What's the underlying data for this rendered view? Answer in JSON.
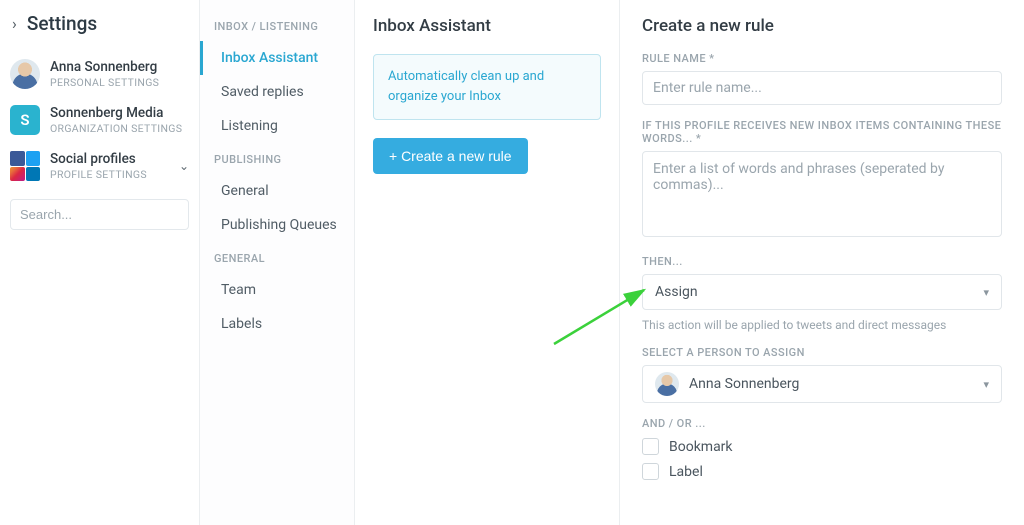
{
  "settings": {
    "title": "Settings",
    "personal": {
      "name": "Anna Sonnenberg",
      "sub": "PERSONAL SETTINGS"
    },
    "org": {
      "name": "Sonnenberg Media",
      "sub": "ORGANIZATION SETTINGS",
      "initial": "S"
    },
    "social": {
      "name": "Social profiles",
      "sub": "PROFILE SETTINGS"
    },
    "search_placeholder": "Search..."
  },
  "nav": {
    "sections": {
      "inbox": {
        "label": "INBOX / LISTENING",
        "items": [
          "Inbox Assistant",
          "Saved replies",
          "Listening"
        ],
        "active_index": 0
      },
      "publishing": {
        "label": "PUBLISHING",
        "items": [
          "General",
          "Publishing Queues"
        ]
      },
      "general": {
        "label": "GENERAL",
        "items": [
          "Team",
          "Labels"
        ]
      }
    }
  },
  "panel": {
    "title": "Inbox Assistant",
    "info_text": "Automatically clean up and organize your Inbox",
    "create_button": "+ Create a new rule"
  },
  "form": {
    "title": "Create a new rule",
    "rule_name_label": "RULE NAME *",
    "rule_name_placeholder": "Enter rule name...",
    "words_label": "IF THIS PROFILE RECEIVES NEW INBOX ITEMS CONTAINING THESE WORDS... *",
    "words_placeholder": "Enter a list of words and phrases (seperated by commas)...",
    "then_label": "THEN...",
    "then_value": "Assign",
    "then_help": "This action will be applied to tweets and direct messages",
    "assign_label": "SELECT A PERSON TO ASSIGN",
    "assign_value": "Anna Sonnenberg",
    "andor_label": "AND / OR ...",
    "options": {
      "bookmark": "Bookmark",
      "label": "Label"
    }
  }
}
